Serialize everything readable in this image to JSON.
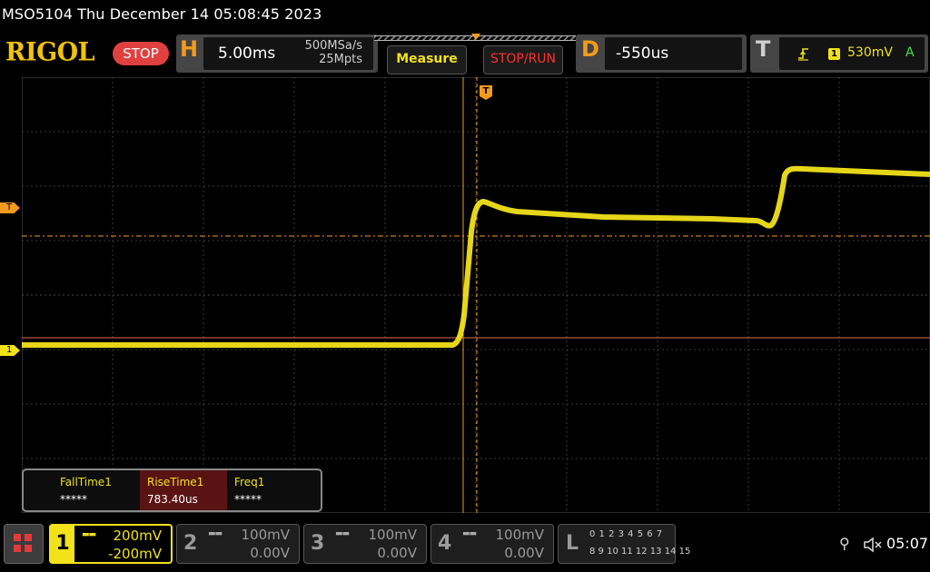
{
  "title": "MSO5104  Thu December 14 05:08:45 2023",
  "brand": "RIGOL",
  "run_state": "STOP",
  "horizontal": {
    "letter": "H",
    "timebase": "5.00ms",
    "sample_rate": "500MSa/s",
    "memory_depth": "25Mpts"
  },
  "buttons": {
    "measure": "Measure",
    "stop_run": "STOP/RUN"
  },
  "delay": {
    "letter": "D",
    "value": "-550us"
  },
  "trigger": {
    "letter": "T",
    "source": "1",
    "level": "530mV",
    "mode": "A"
  },
  "markers": {
    "trigger_level": "T",
    "channel1": "1",
    "trigger_position": "T"
  },
  "measurements": [
    {
      "name": "FallTime1",
      "value": "*****"
    },
    {
      "name": "RiseTime1",
      "value": "783.40us"
    },
    {
      "name": "Freq1",
      "value": "*****"
    }
  ],
  "channels": [
    {
      "num": "1",
      "scale": "200mV",
      "offset": "-200mV",
      "active": true
    },
    {
      "num": "2",
      "scale": "100mV",
      "offset": "0.00V",
      "active": false
    },
    {
      "num": "3",
      "scale": "100mV",
      "offset": "0.00V",
      "active": false
    },
    {
      "num": "4",
      "scale": "100mV",
      "offset": "0.00V",
      "active": false
    }
  ],
  "logic": {
    "letter": "L",
    "row1": "0 1 2 3   4 5 6 7",
    "row2": "8  9 10 11  12 13 14 15"
  },
  "status": {
    "time": "05:07"
  },
  "colors": {
    "ch1": "#f2e21a",
    "accent": "#f29a1e",
    "stop": "#e04040",
    "grid": "#3a3a3a"
  }
}
